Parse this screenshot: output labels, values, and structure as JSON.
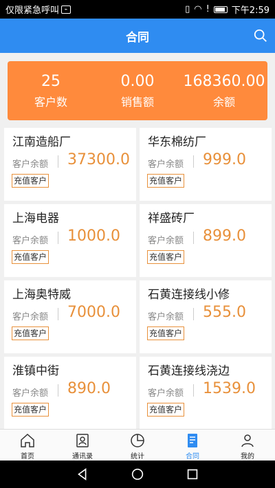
{
  "status_bar": {
    "carrier": "仅限紧急呼叫",
    "time": "下午2:59"
  },
  "header": {
    "title": "合同"
  },
  "summary": [
    {
      "value": "25",
      "label": "客户数"
    },
    {
      "value": "0.00",
      "label": "销售额"
    },
    {
      "value": "168360.00",
      "label": "余额"
    }
  ],
  "customers": [
    {
      "name": "江南造船厂",
      "balance_label": "客户余额",
      "balance": "37300.0",
      "tag": "充值客户"
    },
    {
      "name": "华东棉纺厂",
      "balance_label": "客户余额",
      "balance": "999.0",
      "tag": "充值客户"
    },
    {
      "name": "上海电器",
      "balance_label": "客户余额",
      "balance": "1000.0",
      "tag": "充值客户"
    },
    {
      "name": "祥盛砖厂",
      "balance_label": "客户余额",
      "balance": "899.0",
      "tag": "充值客户"
    },
    {
      "name": "上海奥特威",
      "balance_label": "客户余额",
      "balance": "7000.0",
      "tag": "充值客户"
    },
    {
      "name": "石黄连接线小修",
      "balance_label": "客户余额",
      "balance": "555.0",
      "tag": "充值客户"
    },
    {
      "name": "淮镇中街",
      "balance_label": "客户余额",
      "balance": "890.0",
      "tag": "充值客户"
    },
    {
      "name": "石黄连接线浇边",
      "balance_label": "客户余额",
      "balance": "1539.0",
      "tag": "充值客户"
    }
  ],
  "tabs": [
    {
      "label": "首页",
      "icon": "home-icon"
    },
    {
      "label": "通讯录",
      "icon": "contacts-icon"
    },
    {
      "label": "统计",
      "icon": "pie-chart-icon"
    },
    {
      "label": "合同",
      "icon": "contract-icon"
    },
    {
      "label": "我的",
      "icon": "user-icon"
    }
  ],
  "colors": {
    "primary": "#2f8cf1",
    "accent": "#ff8a3c",
    "balance": "#e8903a"
  }
}
